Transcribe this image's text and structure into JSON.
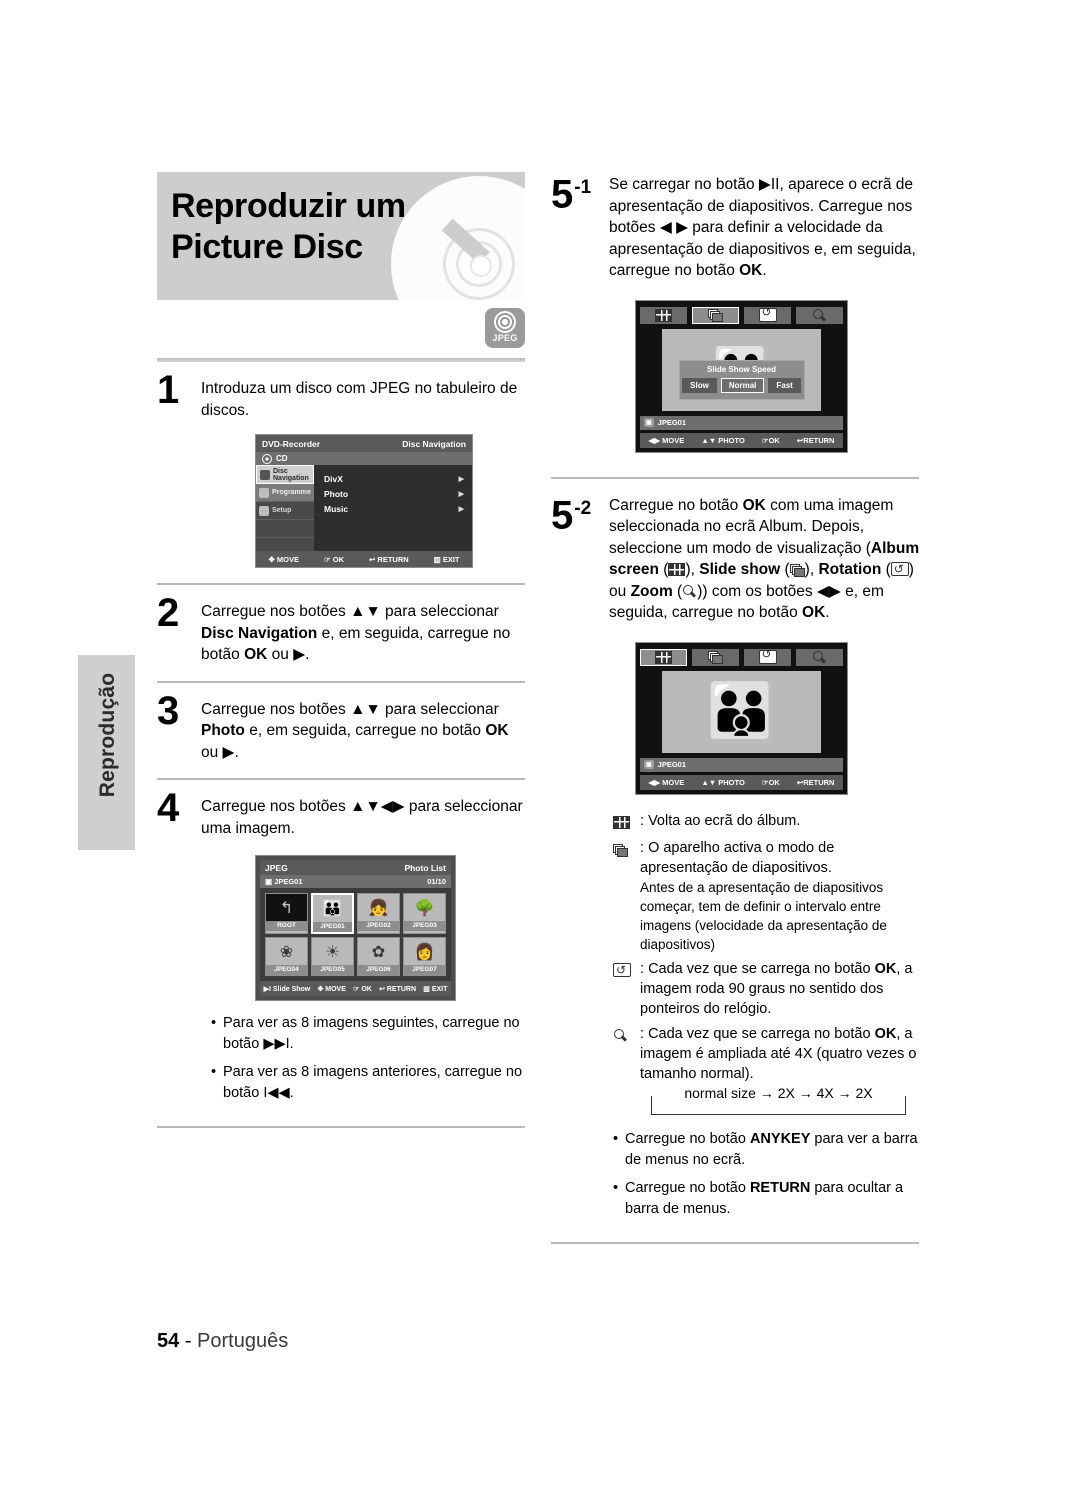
{
  "page": {
    "title_line1": "Reproduzir um",
    "title_line2": "Picture Disc",
    "badge": {
      "label": "JPEG"
    },
    "footer_page": "54",
    "footer_sep": "-",
    "footer_lang": "Português",
    "side_tab": "Reprodução"
  },
  "steps": {
    "s1": {
      "num": "1",
      "text": "Introduza um disco com JPEG no tabuleiro de discos."
    },
    "s2": {
      "num": "2",
      "text_a": "Carregue nos botões ▲▼ para seleccionar ",
      "bold_a": "Disc Navigation",
      "text_b": " e, em seguida, carregue no botão ",
      "bold_b": "OK",
      "text_c": " ou ▶."
    },
    "s3": {
      "num": "3",
      "text_a": "Carregue nos botões ▲▼ para seleccionar ",
      "bold_a": "Photo",
      "text_b": " e, em seguida, carregue no botão ",
      "bold_b": "OK",
      "text_c": " ou ▶."
    },
    "s4": {
      "num": "4",
      "text": "Carregue nos botões ▲▼◀▶ para seleccionar uma imagem."
    },
    "s51": {
      "num": "5",
      "sup": "-1",
      "text_a": "Se carregar no botão ▶II, aparece o ecrã de apresentação de diapositivos. Carregue nos botões ◀ ▶ para definir a velocidade da apresentação de diapositivos e, em seguida, carregue no botão ",
      "bold_a": "OK",
      "text_b": "."
    },
    "s52": {
      "num": "5",
      "sup": "-2",
      "text_a": "Carregue no botão ",
      "bold_a": "OK",
      "text_b": " com uma imagem seleccionada no ecrã Album. Depois, seleccione um modo de visualização (",
      "bold_b": "Album screen",
      "text_c": " (",
      "icon_b": "grid-icon",
      "text_d": "), ",
      "bold_c": "Slide show",
      "text_e": " (",
      "icon_c": "slideshow-icon",
      "text_f": "), ",
      "bold_d": "Rotation",
      "text_g": " (",
      "icon_d": "rotation-icon",
      "text_h": ") ou ",
      "bold_e": "Zoom",
      "text_i": " (",
      "icon_e": "zoom-icon",
      "text_j": ")) com os botões ◀▶ e, em seguida, carregue no botão ",
      "bold_f": "OK",
      "text_k": "."
    }
  },
  "disc_nav": {
    "title_left": "DVD-Recorder",
    "title_right": "Disc Navigation",
    "disc_type": "CD",
    "side_items": [
      {
        "label": "Disc Navigation",
        "state": "selected"
      },
      {
        "label": "Programme",
        "state": "highlight"
      },
      {
        "label": "Setup",
        "state": "normal"
      }
    ],
    "rows": [
      "DivX",
      "Photo",
      "Music"
    ],
    "bottom": [
      "MOVE",
      "OK",
      "RETURN",
      "EXIT"
    ]
  },
  "photo_list": {
    "title_left": "JPEG",
    "title_right": "Photo List",
    "folder": "JPEG01",
    "counter": "01/10",
    "thumbs": [
      {
        "label": "ROOT",
        "glyph": "↰",
        "selected": false,
        "root": true
      },
      {
        "label": "JPEG01",
        "glyph": "👪",
        "selected": true,
        "root": false
      },
      {
        "label": "JPEG02",
        "glyph": "👧",
        "selected": false,
        "root": false
      },
      {
        "label": "JPEG03",
        "glyph": "🌳",
        "selected": false,
        "root": false
      },
      {
        "label": "JPEG04",
        "glyph": "❀",
        "selected": false,
        "root": false
      },
      {
        "label": "JPEG05",
        "glyph": "☀",
        "selected": false,
        "root": false
      },
      {
        "label": "JPEG06",
        "glyph": "✿",
        "selected": false,
        "root": false
      },
      {
        "label": "JPEG07",
        "glyph": "👩",
        "selected": false,
        "root": false
      }
    ],
    "bottom": [
      "Slide Show",
      "MOVE",
      "OK",
      "RETURN",
      "EXIT"
    ]
  },
  "osd_slideshow": {
    "toolbar": [
      "album-icon",
      "slideshow-icon",
      "rotation-icon",
      "zoom-icon"
    ],
    "selected_tool": 1,
    "popup_title": "Slide Show Speed",
    "popup_options": [
      "Slow",
      "Normal",
      "Fast"
    ],
    "popup_selected": "Normal",
    "file_tag": "JPEG01",
    "bottom": [
      "MOVE",
      "PHOTO",
      "OK",
      "RETURN"
    ]
  },
  "osd_album": {
    "toolbar": [
      "album-icon",
      "slideshow-icon",
      "rotation-icon",
      "zoom-icon"
    ],
    "selected_tool": 0,
    "file_tag": "JPEG01",
    "bottom": [
      "MOVE",
      "PHOTO",
      "OK",
      "RETURN"
    ]
  },
  "notes": {
    "album": "Volta ao ecrã do álbum.",
    "slideshow": "O aparelho activa o modo de apresentação de diapositivos.",
    "slideshow_sub": "Antes de a apresentação de diapositivos começar, tem de definir o intervalo entre imagens (velocidade da apresentação de diapositivos)",
    "rotation_a": "Cada vez que se carrega no botão ",
    "rotation_bold": "OK",
    "rotation_b": ", a imagem roda 90 graus no sentido dos ponteiros do relógio.",
    "zoom_a": "Cada vez que se carrega no botão ",
    "zoom_bold": "OK",
    "zoom_b": ", a imagem é ampliada até 4X (quatro vezes o tamanho normal).",
    "cycle": "normal size → 2X → 4X → 2X"
  },
  "bullets": {
    "left": [
      {
        "a": "Para ver as 8 imagens seguintes, carregue no botão ▶▶I."
      },
      {
        "a": "Para ver as 8 imagens anteriores, carregue no botão I◀◀."
      }
    ],
    "right": [
      {
        "a": "Carregue no botão ",
        "bold": "ANYKEY",
        "b": " para ver a barra de menus no ecrã."
      },
      {
        "a": "Carregue no botão ",
        "bold": "RETURN",
        "b": " para ocultar a barra de menus."
      }
    ]
  }
}
